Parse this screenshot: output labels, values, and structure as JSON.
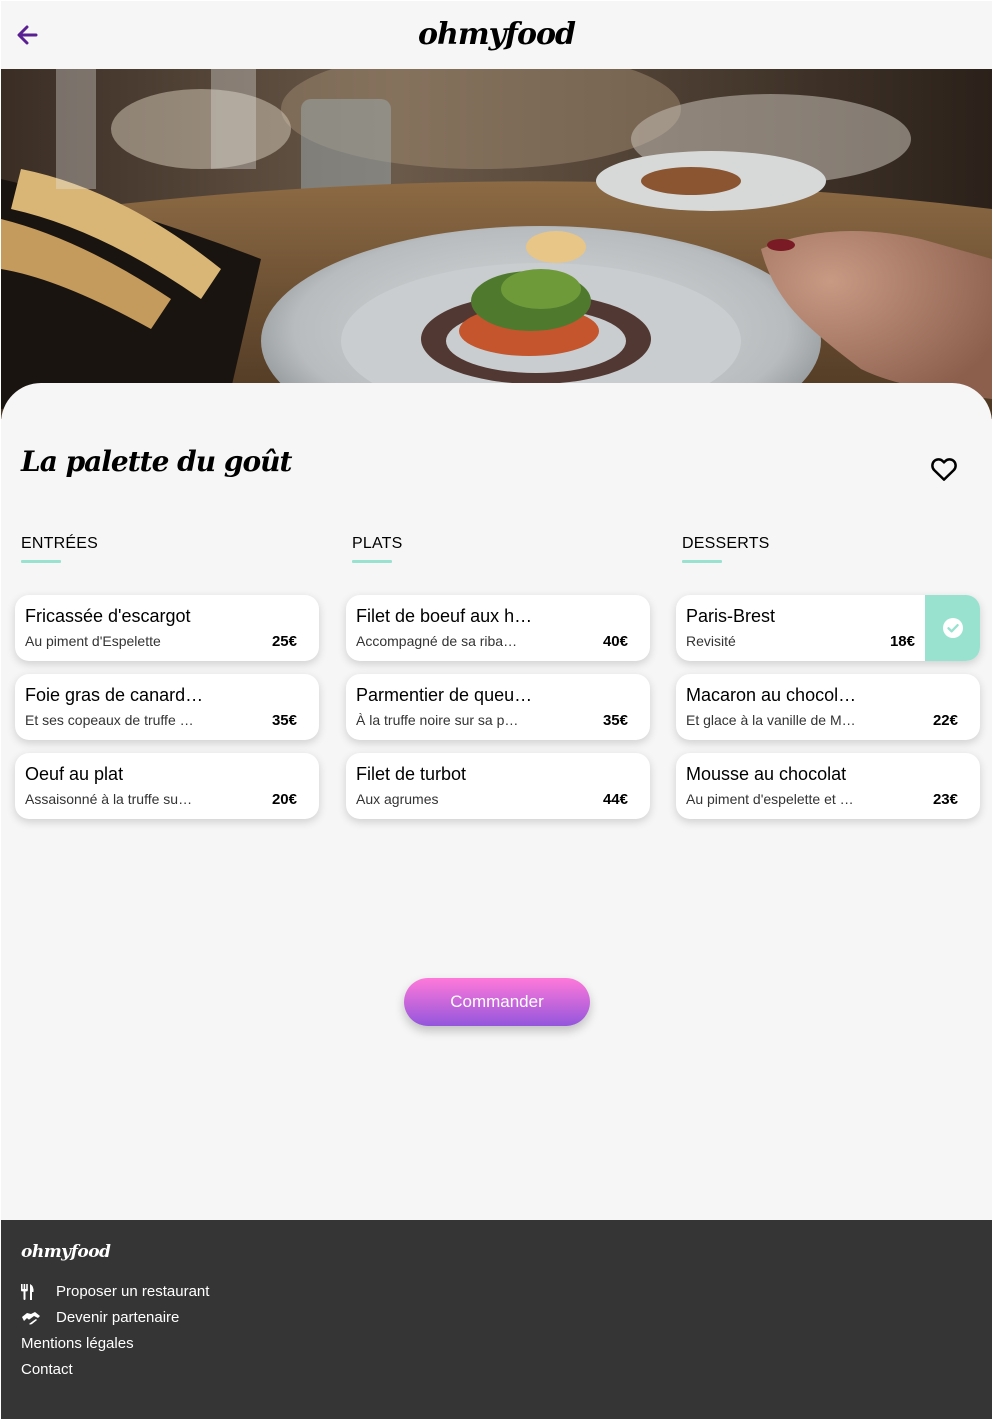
{
  "header": {
    "brand": "ohmyfood",
    "back_icon": "arrow-left-icon",
    "accent": "#5b1f94"
  },
  "hero": {
    "description": ""
  },
  "restaurant": {
    "name": "La palette du goût",
    "favorite_icon": "heart-outline-icon"
  },
  "menu": {
    "columns": [
      {
        "title": "ENTRÉES",
        "dishes": [
          {
            "name": "Fricassée d'escargot",
            "description": "Au piment d'Espelette",
            "price": "25€",
            "selected": false
          },
          {
            "name": "Foie gras de canard…",
            "description": "Et ses copeaux de truffe n…",
            "price": "35€",
            "selected": false
          },
          {
            "name": "Oeuf au plat",
            "description": "Assaisonné à la truffe sur l…",
            "price": "20€",
            "selected": false
          }
        ]
      },
      {
        "title": "PLATS",
        "dishes": [
          {
            "name": "Filet de boeuf aux h…",
            "description": "Accompagné de sa ribam…",
            "price": "40€",
            "selected": false
          },
          {
            "name": "Parmentier de queu…",
            "description": "À la truffe noire sur sa pur…",
            "price": "35€",
            "selected": false
          },
          {
            "name": "Filet de turbot",
            "description": "Aux agrumes",
            "price": "44€",
            "selected": false
          }
        ]
      },
      {
        "title": "DESSERTS",
        "dishes": [
          {
            "name": "Paris-Brest",
            "description": "Revisité",
            "price": "18€",
            "selected": true
          },
          {
            "name": "Macaron au chocol…",
            "description": "Et glace à la vanille de Ma…",
            "price": "22€",
            "selected": false
          },
          {
            "name": "Mousse au chocolat",
            "description": "Au piment d'espelette et à …",
            "price": "23€",
            "selected": false
          }
        ]
      }
    ],
    "selected_color": "#99e2d0",
    "check_icon": "check-circle-icon"
  },
  "order": {
    "label": "Commander"
  },
  "footer": {
    "brand": "ohmyfood",
    "links": [
      {
        "label": "Proposer un restaurant",
        "icon": "utensils-icon"
      },
      {
        "label": "Devenir partenaire",
        "icon": "handshake-icon"
      },
      {
        "label": "Mentions légales",
        "icon": ""
      },
      {
        "label": "Contact",
        "icon": ""
      }
    ]
  }
}
